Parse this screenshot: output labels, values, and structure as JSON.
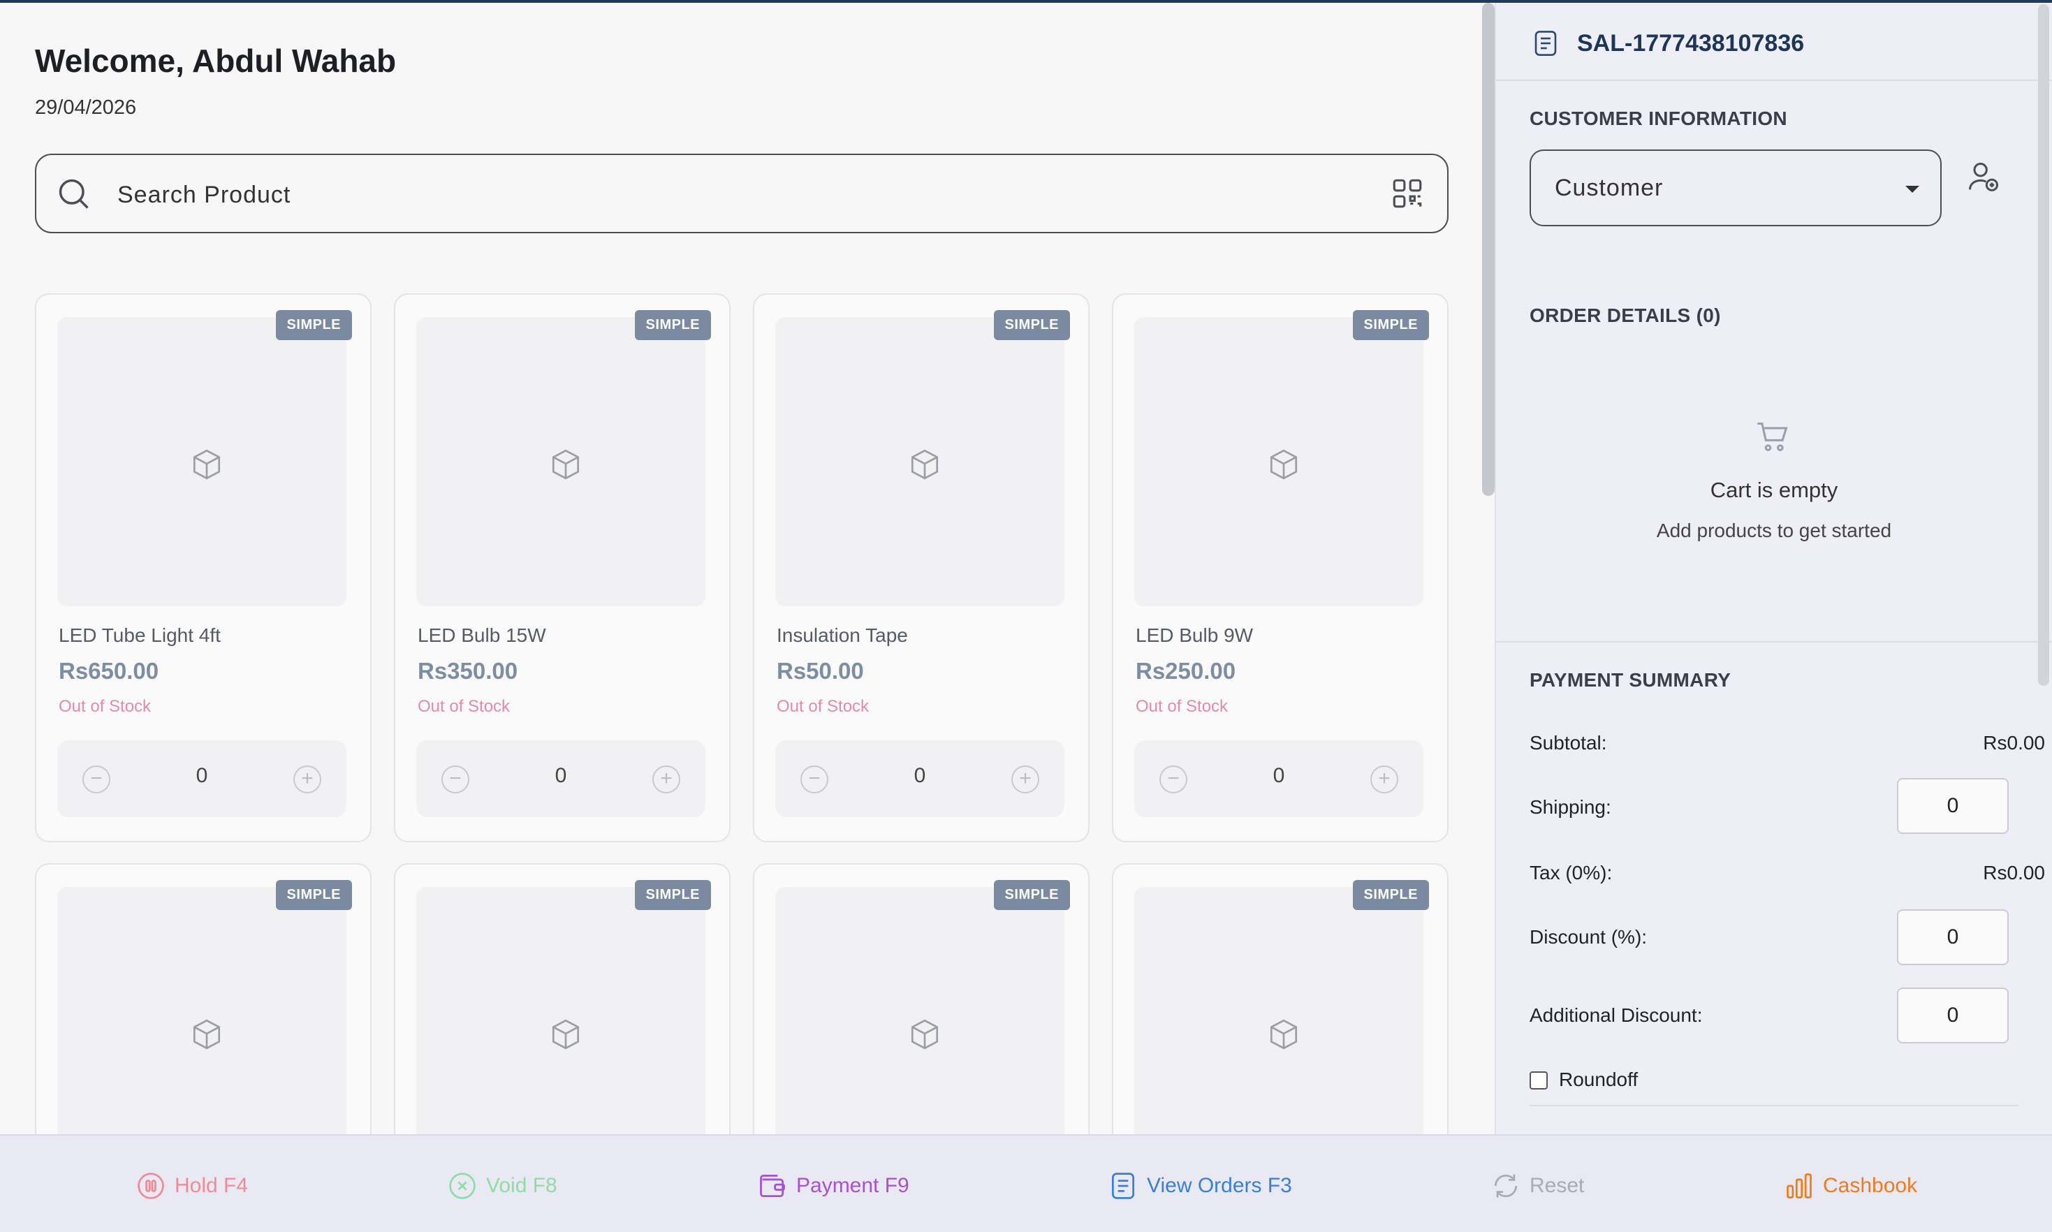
{
  "header": {
    "welcome": "Welcome, Abdul Wahab",
    "date": "29/04/2026"
  },
  "search": {
    "placeholder": "Search Product"
  },
  "products": [
    {
      "badge": "SIMPLE",
      "name": "LED Tube Light 4ft",
      "price": "Rs650.00",
      "stock": "Out of Stock",
      "qty": "0"
    },
    {
      "badge": "SIMPLE",
      "name": "LED Bulb 15W",
      "price": "Rs350.00",
      "stock": "Out of Stock",
      "qty": "0"
    },
    {
      "badge": "SIMPLE",
      "name": "Insulation Tape",
      "price": "Rs50.00",
      "stock": "Out of Stock",
      "qty": "0"
    },
    {
      "badge": "SIMPLE",
      "name": "LED Bulb 9W",
      "price": "Rs250.00",
      "stock": "Out of Stock",
      "qty": "0"
    },
    {
      "badge": "SIMPLE"
    },
    {
      "badge": "SIMPLE"
    },
    {
      "badge": "SIMPLE"
    },
    {
      "badge": "SIMPLE"
    }
  ],
  "sidebar": {
    "invoice_id": "SAL-1777438107836",
    "customer_section": "CUSTOMER INFORMATION",
    "customer_select": "Customer",
    "order_section": "ORDER DETAILS (0)",
    "cart_empty": "Cart is empty",
    "cart_hint": "Add products to get started",
    "payment_section": "PAYMENT SUMMARY",
    "subtotal_label": "Subtotal:",
    "subtotal_value": "Rs0.00",
    "shipping_label": "Shipping:",
    "shipping_value": "0",
    "tax_label": "Tax (0%):",
    "tax_value": "Rs0.00",
    "discount_label": "Discount (%):",
    "discount_value": "0",
    "additional_discount_label": "Additional Discount:",
    "additional_discount_value": "0",
    "roundoff_label": "Roundoff"
  },
  "actions": {
    "hold": "Hold F4",
    "void": "Void F8",
    "payment": "Payment F9",
    "view_orders": "View Orders F3",
    "reset": "Reset",
    "cashbook": "Cashbook"
  },
  "colors": {
    "hold": "#f08b96",
    "void": "#8fdca4",
    "payment": "#a84fd6",
    "view_orders": "#3a7fd6",
    "reset": "#a8abb2",
    "cashbook": "#f07a1e",
    "badge": "#7b8aa0",
    "price": "#7c8da4",
    "out_of_stock": "#e48aa8"
  }
}
